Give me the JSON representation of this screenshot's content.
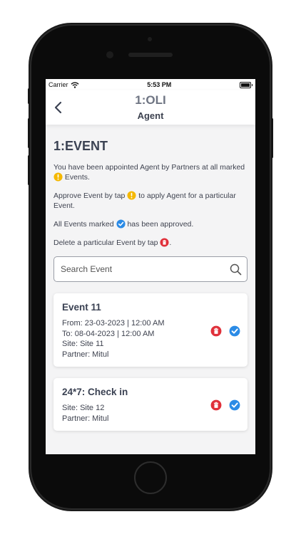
{
  "status_bar": {
    "carrier": "Carrier",
    "time": "5:53 PM"
  },
  "header": {
    "title": "1:OLI",
    "subtitle": "Agent"
  },
  "section": {
    "title": "1:EVENT"
  },
  "info": {
    "line1_a": "You have been appointed Agent by Partners at all marked",
    "line1_b": "Events.",
    "line2_a": "Approve Event by tap",
    "line2_b": "to apply Agent for a particular Event.",
    "line3_a": "All Events marked",
    "line3_b": "has been approved.",
    "line4_a": "Delete a particular Event by tap",
    "line4_b": "."
  },
  "search": {
    "placeholder": "Search Event"
  },
  "events": [
    {
      "title": "Event 11",
      "from": "From: 23-03-2023 | 12:00 AM",
      "to": "To: 08-04-2023 | 12:00 AM",
      "site": "Site: Site 11",
      "partner": "Partner: Mitul"
    },
    {
      "title": "24*7: Check in",
      "site": "Site: Site 12",
      "partner": "Partner: Mitul"
    }
  ],
  "colors": {
    "warning": "#f5b800",
    "approved": "#2b8be6",
    "delete": "#e0303a",
    "title_gray": "#6f7583"
  },
  "icons": [
    "wifi-icon",
    "battery-icon",
    "back-chevron-icon",
    "warning-icon",
    "check-badge-icon",
    "delete-icon",
    "search-icon"
  ]
}
